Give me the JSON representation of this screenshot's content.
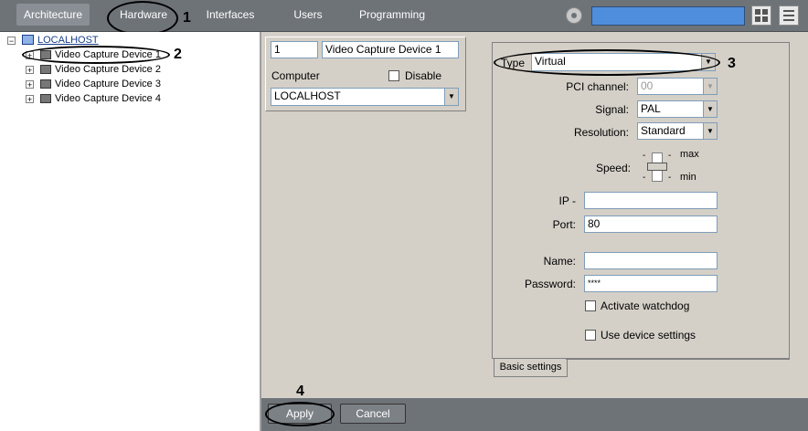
{
  "topbar": {
    "tabs": [
      {
        "label": "Architecture"
      },
      {
        "label": "Hardware"
      },
      {
        "label": "Interfaces"
      },
      {
        "label": "Users"
      },
      {
        "label": "Programming"
      }
    ]
  },
  "tree": {
    "root": "LOCALHOST",
    "items": [
      {
        "label": "Video Capture Device 1"
      },
      {
        "label": "Video Capture Device 2"
      },
      {
        "label": "Video Capture Device 3"
      },
      {
        "label": "Video Capture Device 4"
      }
    ]
  },
  "object_panel": {
    "id_value": "1",
    "name_value": "Video Capture Device 1",
    "computer_label": "Computer",
    "disable_label": "Disable",
    "computer_value": "LOCALHOST"
  },
  "settings": {
    "type_label": "Type",
    "type_value": "Virtual",
    "pci_label": "PCI channel:",
    "pci_value": "00",
    "signal_label": "Signal:",
    "signal_value": "PAL",
    "resolution_label": "Resolution:",
    "resolution_value": "Standard",
    "speed_label": "Speed:",
    "speed_max": "max",
    "speed_min": "min",
    "ip_label": "IP -",
    "ip_value": "",
    "port_label": "Port:",
    "port_value": "80",
    "name_label": "Name:",
    "name_value": "",
    "password_label": "Password:",
    "password_value": "****",
    "watchdog_label": "Activate watchdog",
    "device_settings_label": "Use device settings",
    "tab_label": "Basic settings"
  },
  "bottombar": {
    "apply_label": "Apply",
    "cancel_label": "Cancel"
  },
  "callouts": {
    "n1": "1",
    "n2": "2",
    "n3": "3",
    "n4": "4"
  }
}
